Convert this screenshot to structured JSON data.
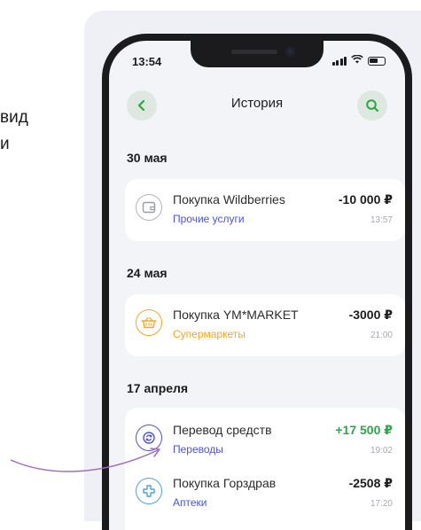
{
  "side_text": {
    "line1": "вид",
    "line2": "и"
  },
  "status_bar": {
    "time": "13:54"
  },
  "header": {
    "title": "История"
  },
  "sections": [
    {
      "date": "30 мая",
      "transactions": [
        {
          "name": "Покупка Wildberries",
          "category": "Прочие услуги",
          "amount": "-10 000 ₽",
          "time": "13:57",
          "icon": "wallet-icon"
        }
      ]
    },
    {
      "date": "24 мая",
      "transactions": [
        {
          "name": "Покупка YM*MARKET",
          "category": "Супермаркеты",
          "amount": "-3000 ₽",
          "time": "21:00",
          "icon": "basket-icon"
        }
      ]
    },
    {
      "date": "17 апреля",
      "transactions": [
        {
          "name": "Перевод средств",
          "category": "Переводы",
          "amount": "+17 500 ₽",
          "time": "19:02",
          "icon": "transfer-icon"
        },
        {
          "name": "Покупка Горздрав",
          "category": "Аптеки",
          "amount": "-2508 ₽",
          "time": "17:20",
          "icon": "pharmacy-cross-icon"
        }
      ]
    }
  ],
  "colors": {
    "accent_green": "#2aa845",
    "category_blue": "#4a54d8",
    "category_orange": "#f5a623",
    "income_green": "#2aa845",
    "header_button_bg": "#dfe7e1",
    "arrow": "#a06ac0"
  }
}
